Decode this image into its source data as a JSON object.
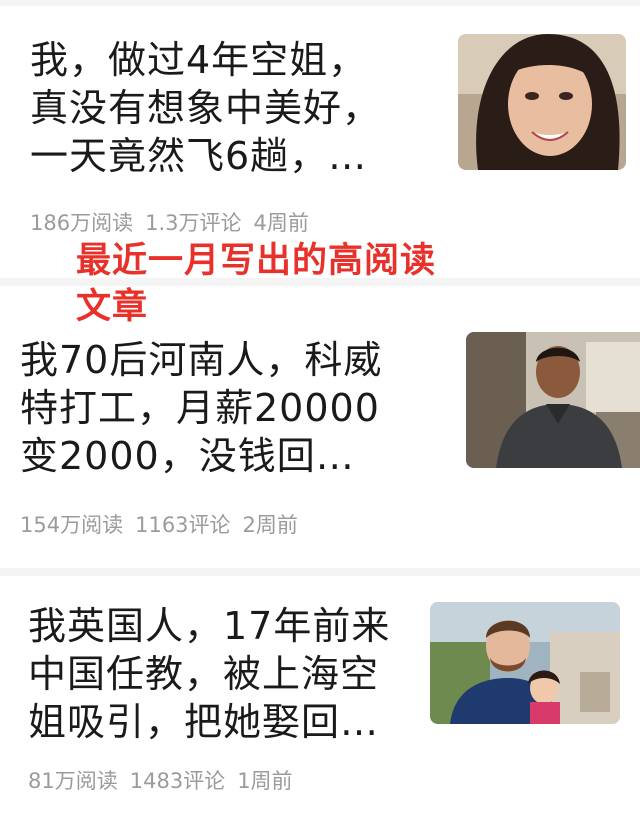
{
  "articles": [
    {
      "title": "我，做过4年空姐，\n真没有想象中美好，\n一天竟然飞6趟，…",
      "reads": "186万阅读",
      "comments": "1.3万评论",
      "time": "4周前",
      "thumb": "woman-portrait"
    },
    {
      "title": "我70后河南人，科威\n特打工，月薪20000\n变2000，没钱回…",
      "reads": "154万阅读",
      "comments": "1163评论",
      "time": "2周前",
      "thumb": "man-at-table"
    },
    {
      "title": "我英国人，17年前来\n中国任教，被上海空\n姐吸引，把她娶回…",
      "reads": "81万阅读",
      "comments": "1483评论",
      "time": "1周前",
      "thumb": "father-and-child"
    }
  ],
  "overlay_note": "最近一月写出的高阅读\n文章",
  "colors": {
    "title": "#1a1a1a",
    "meta": "#9b9b9b",
    "overlay": "#e8312a",
    "separator": "#f4f4f4"
  }
}
